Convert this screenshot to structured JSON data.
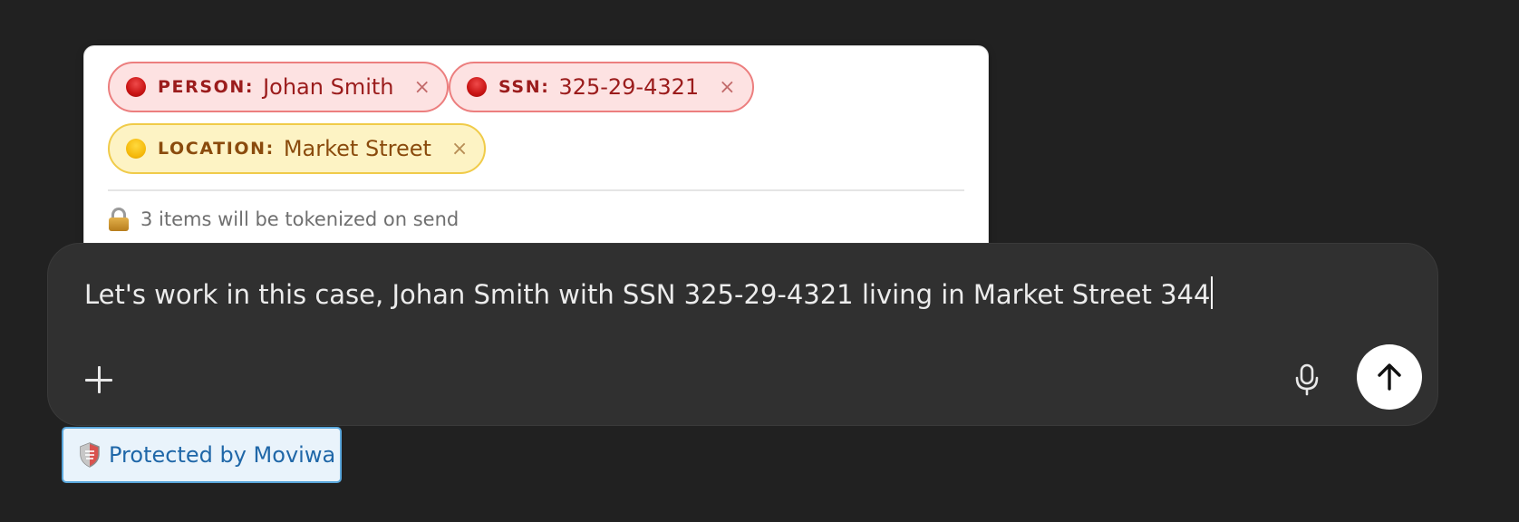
{
  "popover": {
    "chips": [
      {
        "type": "PERSON:",
        "value": "Johan Smith",
        "close": "×",
        "severity": "high"
      },
      {
        "type": "SSN:",
        "value": "325-29-4321",
        "close": "×",
        "severity": "high"
      },
      {
        "type": "LOCATION:",
        "value": "Market Street",
        "close": "×",
        "severity": "medium"
      }
    ],
    "note": "3 items will be tokenized on send"
  },
  "composer": {
    "text": "Let's work in this case, Johan Smith with SSN 325-29-4321 living in Market Street 344"
  },
  "badge": {
    "label": "Protected by Moviwa"
  },
  "colors": {
    "page_bg": "#212121",
    "composer_bg": "#303030",
    "high_chip_bg": "#fde2e2",
    "high_chip_border": "#ec7e7e",
    "medium_chip_bg": "#fdf3c4",
    "medium_chip_border": "#f0cb49",
    "badge_text": "#1f67a8"
  }
}
